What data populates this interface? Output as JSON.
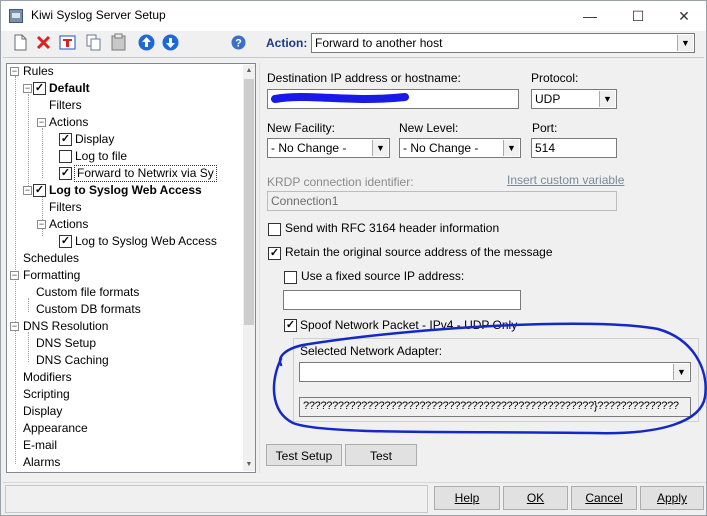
{
  "window": {
    "title": "Kiwi Syslog Server Setup"
  },
  "title_buttons": {
    "minimize": "—",
    "maximize": "☐",
    "close": "✕"
  },
  "toolbar": {
    "icons": [
      "new-document-icon",
      "delete-icon",
      "rename-icon",
      "copy-icon",
      "paste-icon",
      "move-up-icon",
      "move-down-icon",
      "help-icon"
    ]
  },
  "action": {
    "label": "Action:",
    "value": "Forward to another host"
  },
  "tree": {
    "rules": "Rules",
    "default": "Default",
    "filters1": "Filters",
    "actions1": "Actions",
    "display_action": "Display",
    "log_to_file": "Log to file",
    "forward_netwrix": "Forward to Netwrix via Sy",
    "log_web_access_rule": "Log to Syslog Web Access",
    "filters2": "Filters",
    "actions2": "Actions",
    "log_web_access_action": "Log to Syslog Web Access",
    "schedules": "Schedules",
    "formatting": "Formatting",
    "custom_file_formats": "Custom file formats",
    "custom_db_formats": "Custom DB formats",
    "dns_resolution": "DNS Resolution",
    "dns_setup": "DNS Setup",
    "dns_caching": "DNS Caching",
    "modifiers": "Modifiers",
    "scripting": "Scripting",
    "display": "Display",
    "appearance": "Appearance",
    "email": "E-mail",
    "alarms": "Alarms"
  },
  "form": {
    "dest_label": "Destination IP address or hostname:",
    "protocol_label": "Protocol:",
    "protocol_value": "UDP",
    "new_facility_label": "New Facility:",
    "new_facility_value": "- No Change -",
    "new_level_label": "New Level:",
    "new_level_value": "- No Change -",
    "port_label": "Port:",
    "port_value": "514",
    "krdp_label": "KRDP connection identifier:",
    "insert_custom_variable": "Insert custom variable",
    "krdp_value": "Connection1",
    "rfc3164_label": "Send with RFC 3164 header information",
    "retain_label": "Retain the original source address of the message",
    "fixed_source_label": "Use a fixed source IP address:",
    "spoof_label": "Spoof Network Packet - IPv4 - UDP Only",
    "adapter_label": "Selected Network Adapter:",
    "adapter_info": "??????????????????????????????????????????????????}??????????????"
  },
  "buttons": {
    "test_setup": "Test Setup",
    "test": "Test",
    "help": "Help",
    "ok": "OK",
    "cancel": "Cancel",
    "apply": "Apply"
  },
  "colors": {
    "annotation": "#1428c8",
    "redaction": "#1a1ae6",
    "action_label": "#1a3a8a"
  }
}
